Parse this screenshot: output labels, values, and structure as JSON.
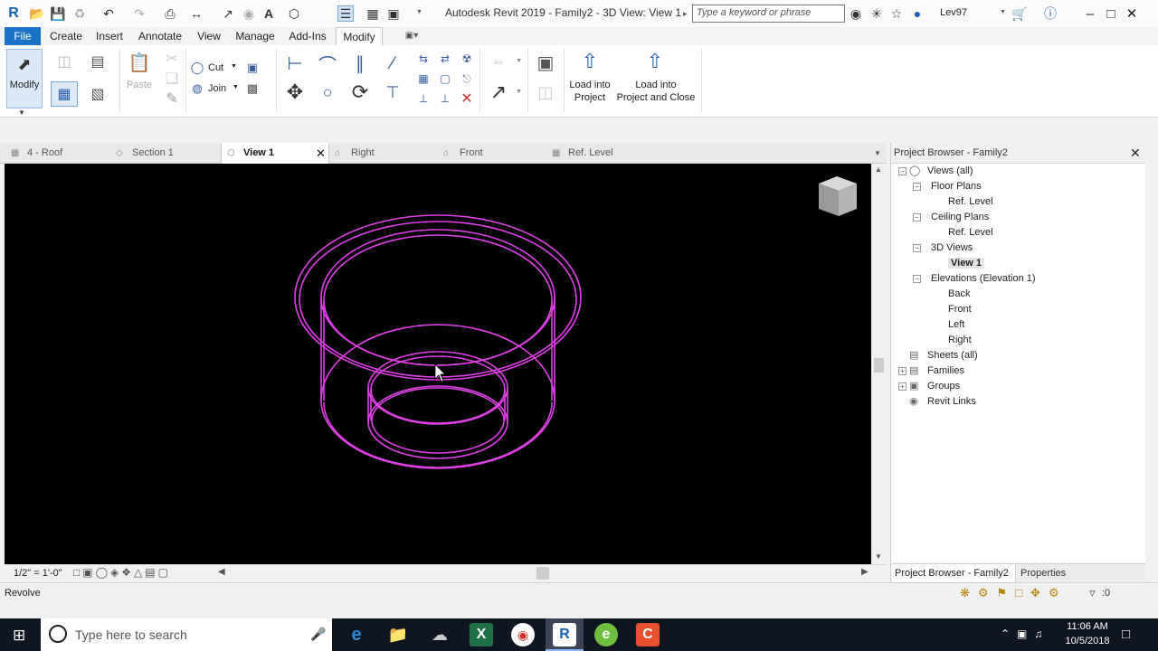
{
  "window": {
    "title": "Autodesk Revit 2019 - Family2 - 3D View: View 1",
    "search_placeholder": "Type a keyword or phrase",
    "user": "Lev97",
    "app_letter": "R"
  },
  "ribbon_tabs": [
    "File",
    "Create",
    "Insert",
    "Annotate",
    "View",
    "Manage",
    "Add-Ins",
    "Modify"
  ],
  "ribbon": {
    "modify_label": "Modify",
    "paste_label": "Paste",
    "cut_label": "Cut",
    "join_label": "Join",
    "load_project_line1": "Load into",
    "load_project_line2": "Project",
    "load_close_line1": "Load into",
    "load_close_line2": "Project and Close"
  },
  "view_tabs": [
    "4 - Roof",
    "Section 1",
    "View 1",
    "Right",
    "Front",
    "Ref. Level"
  ],
  "view_bar": {
    "scale": "1/2\" = 1'-0\""
  },
  "project_browser": {
    "title": "Project Browser - Family2",
    "tree": [
      {
        "label": "Views (all)",
        "level": 0,
        "toggle": "-"
      },
      {
        "label": "Floor Plans",
        "level": 1,
        "toggle": "-"
      },
      {
        "label": "Ref. Level",
        "level": 2
      },
      {
        "label": "Ceiling Plans",
        "level": 1,
        "toggle": "-"
      },
      {
        "label": "Ref. Level",
        "level": 2
      },
      {
        "label": "3D Views",
        "level": 1,
        "toggle": "-"
      },
      {
        "label": "View 1",
        "level": 2,
        "selected": true
      },
      {
        "label": "Elevations (Elevation 1)",
        "level": 1,
        "toggle": "-"
      },
      {
        "label": "Back",
        "level": 2
      },
      {
        "label": "Front",
        "level": 2
      },
      {
        "label": "Left",
        "level": 2
      },
      {
        "label": "Right",
        "level": 2
      },
      {
        "label": "Sheets (all)",
        "level": 0
      },
      {
        "label": "Families",
        "level": 0,
        "toggle": "+"
      },
      {
        "label": "Groups",
        "level": 0,
        "toggle": "+"
      },
      {
        "label": "Revit Links",
        "level": 0
      }
    ],
    "tab_browser": "Project Browser - Family2",
    "tab_properties": "Properties"
  },
  "status": {
    "text": "Revolve",
    "filter_count": ":0"
  },
  "taskbar": {
    "search_placeholder": "Type here to search",
    "time": "11:06 AM",
    "date": "10/5/2018"
  },
  "colors": {
    "file_tab": "#1a73c7",
    "geometry": "#e040e8",
    "canvas": "#000000",
    "taskbar": "#101621"
  }
}
